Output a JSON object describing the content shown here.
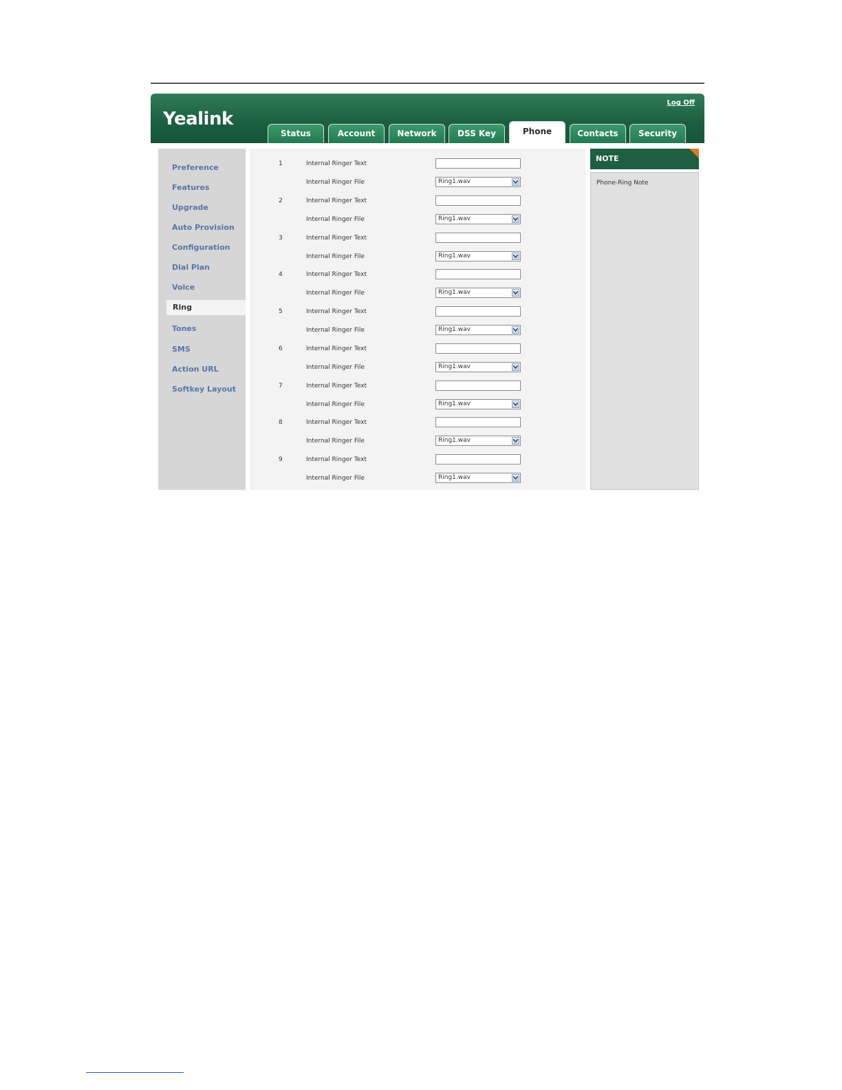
{
  "app": {
    "logo": "Yealink",
    "logoff": "Log Off",
    "tabs": [
      "Status",
      "Account",
      "Network",
      "DSS Key",
      "Phone",
      "Contacts",
      "Security"
    ],
    "active_tab": "Phone"
  },
  "sidebar": {
    "items": [
      "Preference",
      "Features",
      "Upgrade",
      "Auto Provision",
      "Configuration",
      "Dial Plan",
      "Voice",
      "Ring",
      "Tones",
      "SMS",
      "Action URL",
      "Softkey Layout"
    ],
    "active": "Ring"
  },
  "main": {
    "text_label": "Internal Ringer Text",
    "file_label": "Internal Ringer File",
    "rows": [
      {
        "num": "1",
        "text_value": "",
        "file_value": "Ring1.wav"
      },
      {
        "num": "2",
        "text_value": "",
        "file_value": "Ring1.wav"
      },
      {
        "num": "3",
        "text_value": "",
        "file_value": "Ring1.wav"
      },
      {
        "num": "4",
        "text_value": "",
        "file_value": "Ring1.wav"
      },
      {
        "num": "5",
        "text_value": "",
        "file_value": "Ring1.wav"
      },
      {
        "num": "6",
        "text_value": "",
        "file_value": "Ring1.wav"
      },
      {
        "num": "7",
        "text_value": "",
        "file_value": "Ring1.wav"
      },
      {
        "num": "8",
        "text_value": "",
        "file_value": "Ring1.wav"
      },
      {
        "num": "9",
        "text_value": "",
        "file_value": "Ring1.wav"
      }
    ]
  },
  "note": {
    "title": "NOTE",
    "text": "Phone-Ring Note"
  },
  "colors": {
    "header_green": "#1b5e40",
    "sidebar_link": "#5676a6",
    "note_corner": "#e07a1f"
  }
}
